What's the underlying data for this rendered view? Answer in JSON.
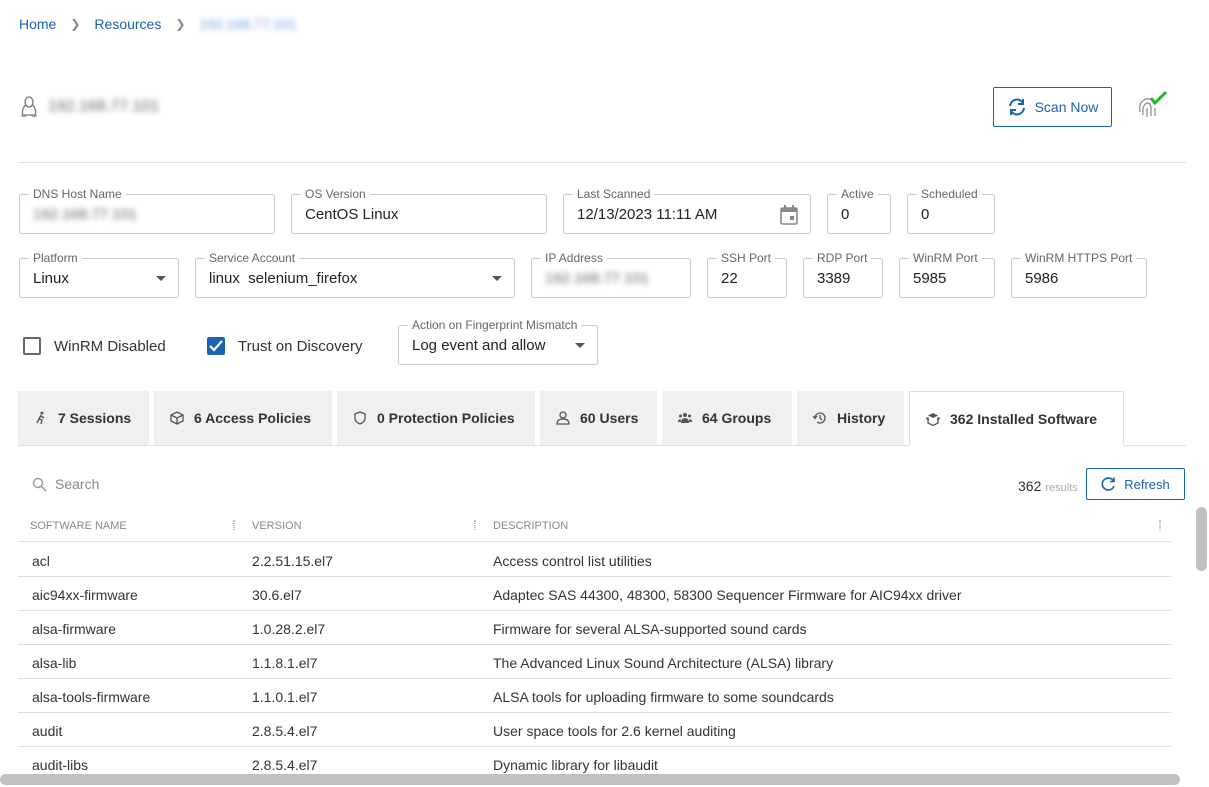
{
  "breadcrumb": {
    "home": "Home",
    "resources": "Resources",
    "current": "192.168.77.101"
  },
  "header": {
    "title": "192.168.77.101",
    "scan_label": "Scan Now"
  },
  "form": {
    "dns": {
      "label": "DNS Host Name",
      "value": "192.168.77.101"
    },
    "os": {
      "label": "OS Version",
      "value": "CentOS Linux"
    },
    "last_scanned": {
      "label": "Last Scanned",
      "value": "12/13/2023 11:11 AM"
    },
    "active": {
      "label": "Active",
      "value": "0"
    },
    "scheduled": {
      "label": "Scheduled",
      "value": "0"
    },
    "platform": {
      "label": "Platform",
      "value": "Linux"
    },
    "service_account": {
      "label": "Service Account",
      "value": "linux  selenium_firefox"
    },
    "ip": {
      "label": "IP Address",
      "value": "192.168.77.101"
    },
    "ssh": {
      "label": "SSH Port",
      "value": "22"
    },
    "rdp": {
      "label": "RDP Port",
      "value": "3389"
    },
    "winrm": {
      "label": "WinRM Port",
      "value": "5985"
    },
    "winrm_https": {
      "label": "WinRM HTTPS Port",
      "value": "5986"
    },
    "winrm_disabled": {
      "label": "WinRM Disabled",
      "checked": false
    },
    "trust_on_discovery": {
      "label": "Trust on Discovery",
      "checked": true
    },
    "fingerprint": {
      "label": "Action on Fingerprint Mismatch",
      "value": "Log event and allow"
    }
  },
  "tabs": [
    {
      "label": "7 Sessions",
      "icon": "person-walking-icon"
    },
    {
      "label": "6 Access Policies",
      "icon": "cube-icon"
    },
    {
      "label": "0 Protection Policies",
      "icon": "shield-icon"
    },
    {
      "label": "60 Users",
      "icon": "user-icon"
    },
    {
      "label": "64 Groups",
      "icon": "users-icon"
    },
    {
      "label": "History",
      "icon": "history-icon"
    },
    {
      "label": "362 Installed Software",
      "icon": "software-icon",
      "active": true
    }
  ],
  "table": {
    "search_placeholder": "Search",
    "results_count": "362",
    "results_label": "results",
    "refresh_label": "Refresh",
    "columns": [
      "SOFTWARE NAME",
      "VERSION",
      "DESCRIPTION"
    ],
    "rows": [
      [
        "acl",
        "2.2.51.15.el7",
        "Access control list utilities"
      ],
      [
        "aic94xx-firmware",
        "30.6.el7",
        "Adaptec SAS 44300, 48300, 58300 Sequencer Firmware for AIC94xx driver"
      ],
      [
        "alsa-firmware",
        "1.0.28.2.el7",
        "Firmware for several ALSA-supported sound cards"
      ],
      [
        "alsa-lib",
        "1.1.8.1.el7",
        "The Advanced Linux Sound Architecture (ALSA) library"
      ],
      [
        "alsa-tools-firmware",
        "1.1.0.1.el7",
        "ALSA tools for uploading firmware to some soundcards"
      ],
      [
        "audit",
        "2.8.5.4.el7",
        "User space tools for 2.6 kernel auditing"
      ],
      [
        "audit-libs",
        "2.8.5.4.el7",
        "Dynamic library for libaudit"
      ]
    ]
  },
  "colors": {
    "accent": "#1a63b0",
    "check": "#2bb52b"
  }
}
